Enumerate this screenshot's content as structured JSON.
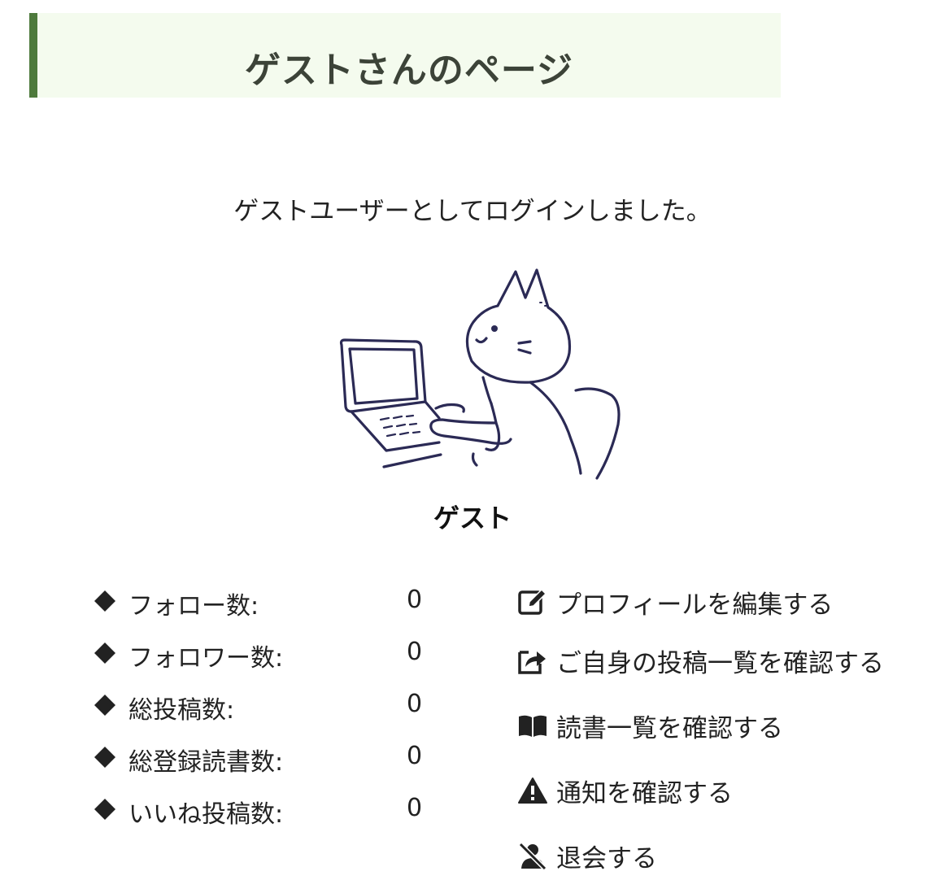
{
  "header": {
    "title": "ゲストさんのページ"
  },
  "login_message": "ゲストユーザーとしてログインしました。",
  "profile": {
    "username": "ゲスト"
  },
  "stats": [
    {
      "label": "フォロー数:",
      "value": "0"
    },
    {
      "label": "フォロワー数:",
      "value": "0"
    },
    {
      "label": "総投稿数:",
      "value": "0"
    },
    {
      "label": "総登録読書数:",
      "value": "0"
    },
    {
      "label": "いいね投稿数:",
      "value": "0"
    }
  ],
  "actions": [
    {
      "label": "プロフィールを編集する",
      "icon": "edit-icon"
    },
    {
      "label": "ご自身の投稿一覧を確認する",
      "icon": "share-icon"
    },
    {
      "label": "読書一覧を確認する",
      "icon": "book-icon"
    },
    {
      "label": "通知を確認する",
      "icon": "warning-icon"
    },
    {
      "label": "退会する",
      "icon": "user-remove-icon"
    }
  ],
  "colors": {
    "header_accent": "#4e7a3c",
    "header_background": "#f4fbee",
    "illustration_stroke": "#2b2a55"
  }
}
